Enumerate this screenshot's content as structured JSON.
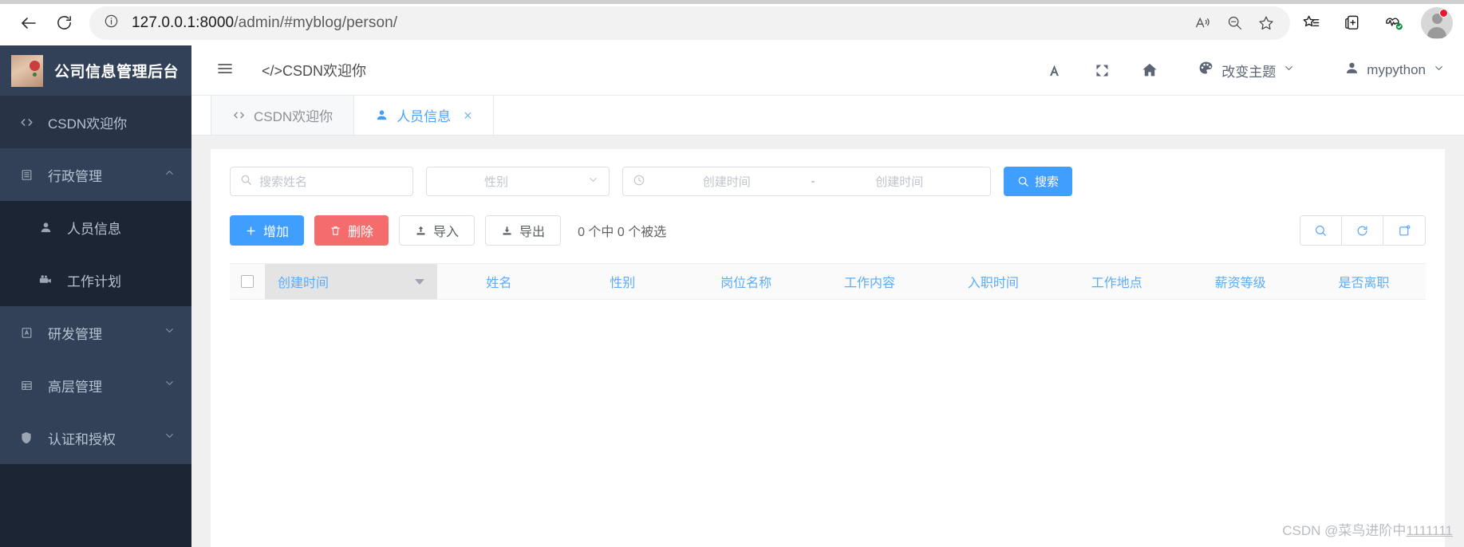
{
  "browser": {
    "back_icon": "back-arrow-icon",
    "reload_icon": "reload-icon",
    "info_icon": "info-circle-icon",
    "url_host": "127.0.0.1:8000",
    "url_path": "/admin/#myblog/person/",
    "read_aloud_icon": "read-aloud-icon",
    "zoom_out_icon": "zoom-out-icon",
    "favorite_icon": "star-icon",
    "collections_icon": "collections-icon",
    "split_screen_icon": "split-screen-icon",
    "performance_icon": "browser-essentials-icon",
    "profile_icon": "profile-avatar-icon"
  },
  "sidebar": {
    "brand_title": "公司信息管理后台",
    "brand_logo_icon": "cat-avatar-logo",
    "items": [
      {
        "label": "CSDN欢迎你",
        "icon": "code-icon",
        "level": "top",
        "chevron": ""
      },
      {
        "label": "行政管理",
        "icon": "building-icon",
        "level": "group",
        "chevron": "⌃"
      },
      {
        "label": "人员信息",
        "icon": "user-icon",
        "level": "sub",
        "chevron": ""
      },
      {
        "label": "工作计划",
        "icon": "projector-icon",
        "level": "sub",
        "chevron": ""
      },
      {
        "label": "研发管理",
        "icon": "flask-icon",
        "level": "group-collapsed",
        "chevron": "⌄"
      },
      {
        "label": "高层管理",
        "icon": "table-icon",
        "level": "group-collapsed",
        "chevron": "⌄"
      },
      {
        "label": "认证和授权",
        "icon": "shield-icon",
        "level": "group-collapsed",
        "chevron": "⌄"
      }
    ]
  },
  "topbar": {
    "hamburger_icon": "menu-icon",
    "title": "</>CSDN欢迎你",
    "font_icon": "font-size-icon",
    "fullscreen_icon": "fullscreen-icon",
    "home_icon": "home-icon",
    "theme_icon": "palette-icon",
    "theme_label": "改变主题",
    "theme_chevron": "⌄",
    "user_icon": "user-icon",
    "user_label": "mypython",
    "user_chevron": "⌄"
  },
  "tabs": [
    {
      "label": "CSDN欢迎你",
      "icon": "code-icon",
      "active": false,
      "closable": false
    },
    {
      "label": "人员信息",
      "icon": "user-icon",
      "active": true,
      "closable": true,
      "close_glyph": "×"
    }
  ],
  "filters": {
    "name_placeholder": "搜索姓名",
    "name_value": "",
    "name_icon": "search-icon",
    "gender_placeholder": "性别",
    "gender_value": "",
    "gender_chevron_icon": "chevron-down-icon",
    "date_icon": "clock-icon",
    "date_start_placeholder": "创建时间",
    "date_end_placeholder": "创建时间",
    "date_separator": "-",
    "search_button_label": "搜索",
    "search_button_icon": "search-icon"
  },
  "actions": {
    "add_label": "增加",
    "add_icon": "plus-icon",
    "delete_label": "删除",
    "delete_icon": "trash-icon",
    "import_label": "导入",
    "import_icon": "upload-icon",
    "export_label": "导出",
    "export_icon": "download-icon",
    "selection_text": "0 个中 0 个被选",
    "icon_buttons": [
      {
        "icon": "search-icon",
        "name": "table-search-button"
      },
      {
        "icon": "refresh-icon",
        "name": "table-refresh-button"
      },
      {
        "icon": "columns-icon",
        "name": "table-columns-button"
      }
    ]
  },
  "table": {
    "select_all_checked": false,
    "sorted_column": "创建时间",
    "sort_caret_icon": "caret-down-icon",
    "columns": [
      "姓名",
      "性别",
      "岗位名称",
      "工作内容",
      "入职时间",
      "工作地点",
      "薪资等级",
      "是否离职"
    ],
    "rows": []
  },
  "watermark": {
    "prefix": "CSDN @菜鸟进阶中",
    "suffix": "1111111"
  },
  "colors": {
    "primary": "#409eff",
    "danger": "#f56c6c",
    "sidebar_bg": "#1b2533",
    "sidebar_group": "#324157",
    "header_text": "#5cacf7"
  }
}
